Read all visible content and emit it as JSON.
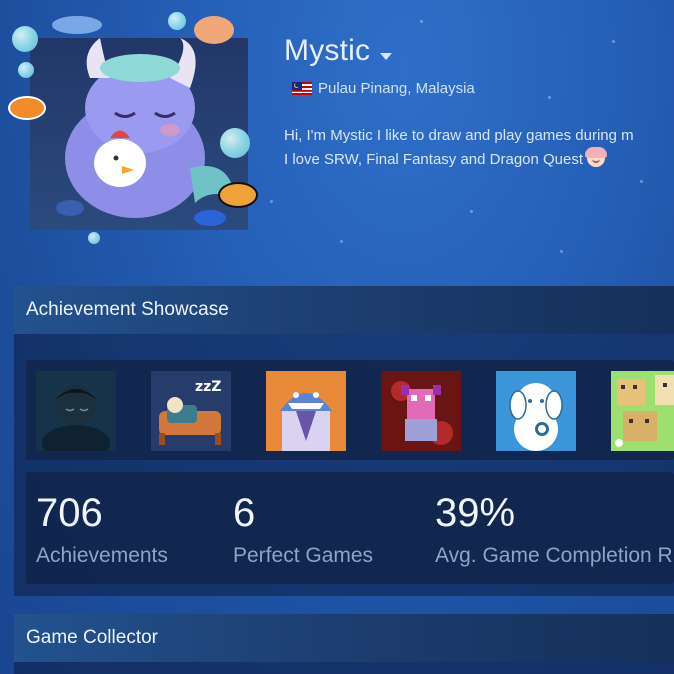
{
  "profile": {
    "persona_name": "Mystic",
    "location": "Pulau Pinang, Malaysia",
    "summary_line1": "Hi, I'm Mystic I like to draw and play games during m",
    "summary_line2": "I love SRW, Final Fantasy and Dragon Quest",
    "flag_icon": "malaysia-flag-icon",
    "avatar_icon": "sleeping-monster-avatar-icon"
  },
  "achievement_showcase": {
    "title": "Achievement Showcase",
    "achievements": [
      {
        "icon": "dark-sleeping-boy-icon"
      },
      {
        "icon": "sleeping-in-bed-zzz-icon"
      },
      {
        "icon": "shark-in-suit-icon"
      },
      {
        "icon": "pink-demon-icon"
      },
      {
        "icon": "white-dog-ribbon-icon"
      },
      {
        "icon": "pixel-dogs-icon"
      }
    ],
    "stats": [
      {
        "value": "706",
        "label": "Achievements"
      },
      {
        "value": "6",
        "label": "Perfect Games"
      },
      {
        "value": "39%",
        "label": "Avg. Game Completion R"
      }
    ]
  },
  "game_collector": {
    "title": "Game Collector"
  },
  "colors": {
    "background": "#2660b8",
    "section_header": "#23528f",
    "text_muted": "#8fa3c3"
  }
}
